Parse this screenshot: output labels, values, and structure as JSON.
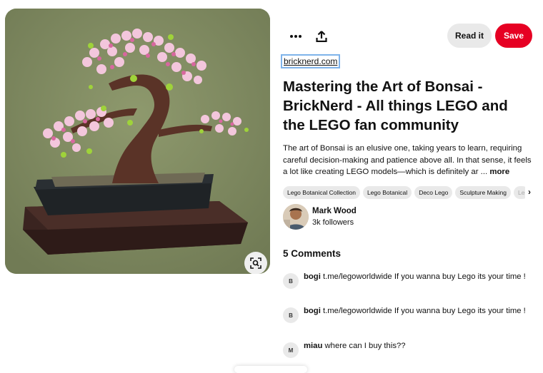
{
  "pin": {
    "image_alt": "LEGO bonsai tree with pink blossoms",
    "lens_icon": "visual-search-icon"
  },
  "toolbar": {
    "more_icon": "more-dots-icon",
    "share_icon": "share-icon",
    "read_it_label": "Read it",
    "save_label": "Save",
    "save_color": "#e60023"
  },
  "source": {
    "domain": "bricknerd.com"
  },
  "title": "Mastering the Art of Bonsai - BrickNerd - All things LEGO and the LEGO fan community",
  "description": {
    "text": "The art of Bonsai is an elusive one, taking years to learn, requiring careful decision-making and patience above all. In that sense, it feels a lot like creating LEGO models—which is definitely ar ...",
    "more_label": "more"
  },
  "tags": [
    "Lego Botanical Collection",
    "Lego Botanical",
    "Deco Lego",
    "Sculpture Making",
    "Le"
  ],
  "author": {
    "name": "Mark Wood",
    "followers": "3k followers"
  },
  "comments": {
    "heading": "5 Comments",
    "items": [
      {
        "initial": "B",
        "user": "bogi",
        "text": "t.me/legoworldwide If you wanna buy Lego its your time !"
      },
      {
        "initial": "B",
        "user": "bogi",
        "text": "t.me/legoworldwide If you wanna buy Lego its your time !"
      },
      {
        "initial": "M",
        "user": "miau",
        "text": "where can I buy this??"
      }
    ]
  }
}
